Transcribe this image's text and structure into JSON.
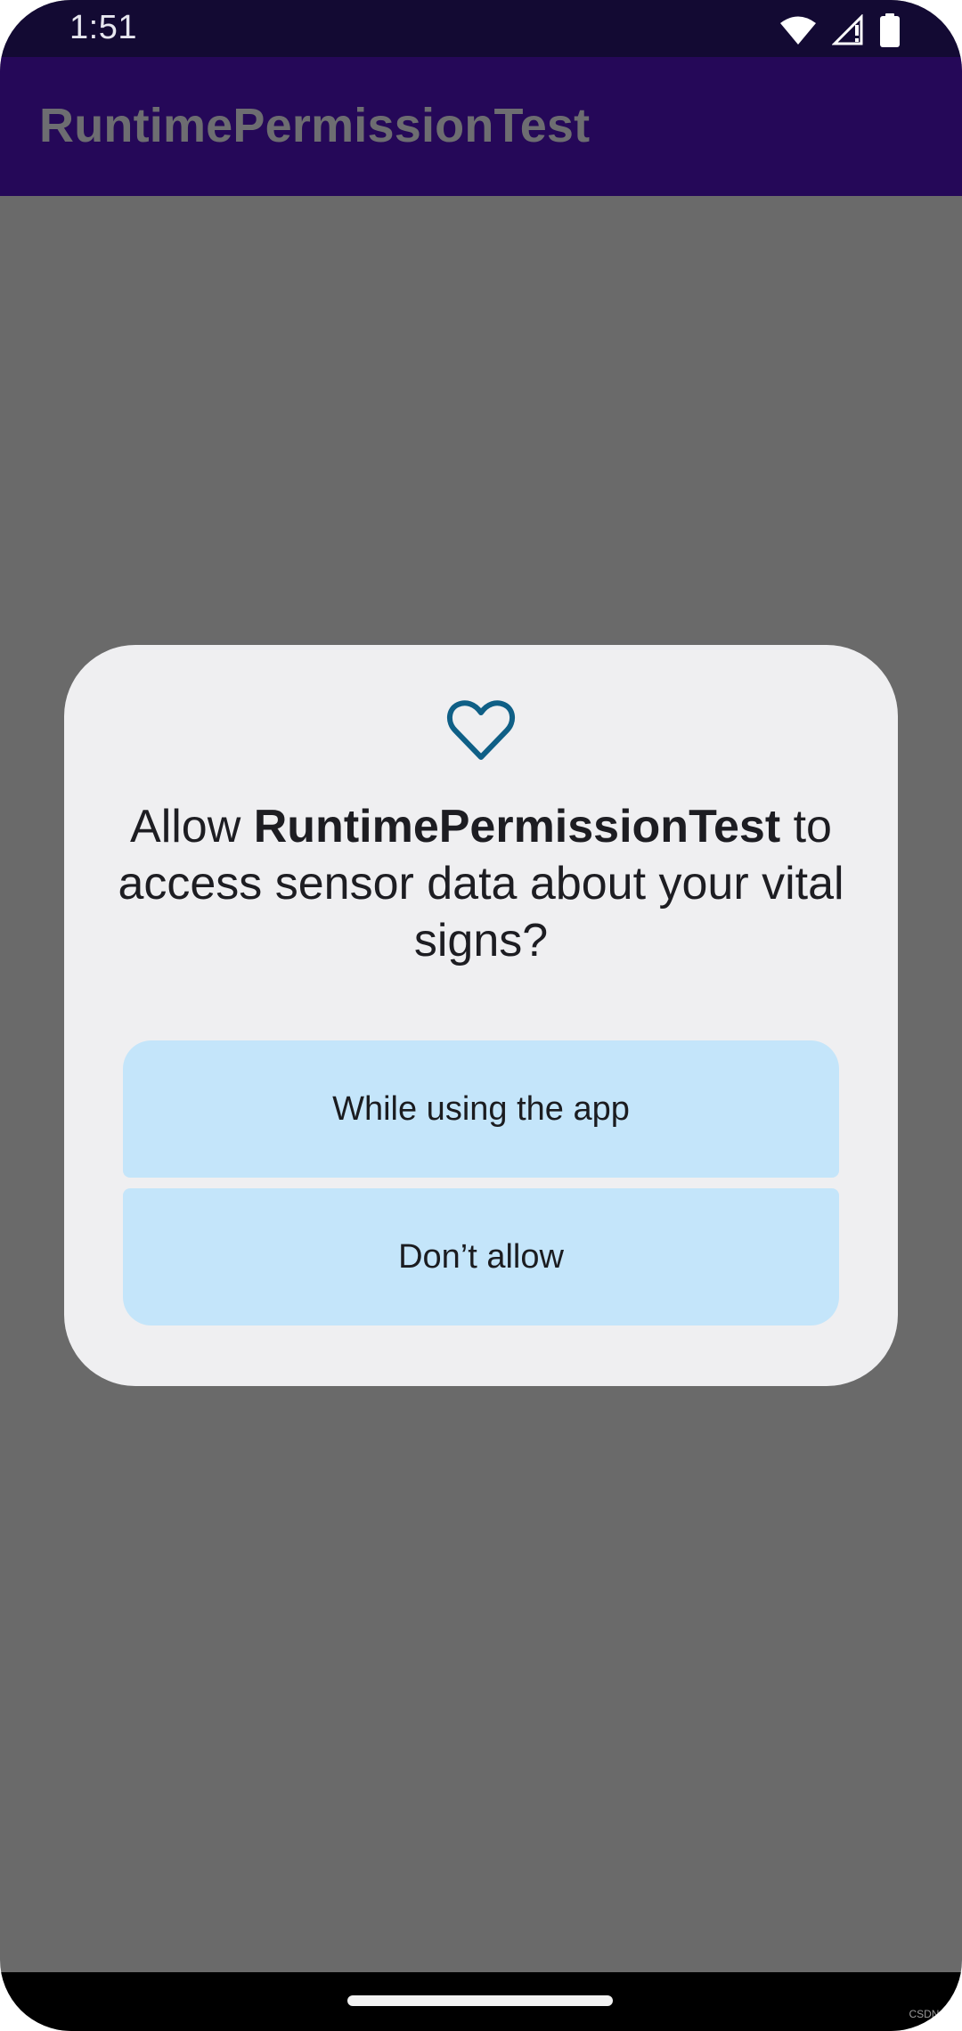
{
  "status_bar": {
    "time": "1:51",
    "icons": [
      "wifi-icon",
      "signal-icon",
      "battery-icon"
    ]
  },
  "app_bar": {
    "title": "RuntimePermissionTest"
  },
  "permission_dialog": {
    "icon": "heart-outline-icon",
    "message_prefix": "Allow ",
    "app_name": "RuntimePermissionTest",
    "message_suffix": " to access sensor data about your vital signs?",
    "allow_while_using_label": "While using the app",
    "deny_label": "Don’t allow"
  },
  "watermark": "CSDN @",
  "colors": {
    "status_bar": "#130a33",
    "app_bar": "#250858",
    "scrim": "#6a6a6a",
    "dialog_surface": "#efeff1",
    "button_fill": "#c4e5fa",
    "icon_accent": "#0f5f86"
  }
}
